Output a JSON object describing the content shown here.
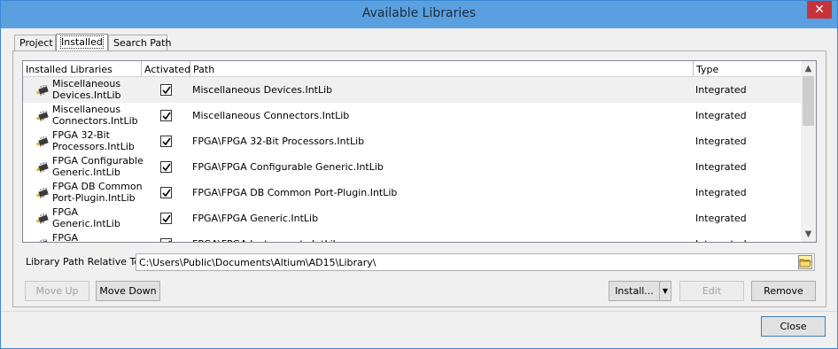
{
  "window": {
    "title": "Available Libraries",
    "close_glyph": "✕"
  },
  "tabs": [
    {
      "label": "Project"
    },
    {
      "label": "Installed"
    },
    {
      "label": "Search Path"
    }
  ],
  "grid": {
    "columns": [
      "Installed Libraries",
      "Activated",
      "Path",
      "Type"
    ],
    "rows": [
      {
        "name_l1": "Miscellaneous",
        "name_l2": "Devices.IntLib",
        "activated": true,
        "path": "Miscellaneous Devices.IntLib",
        "type": "Integrated"
      },
      {
        "name_l1": "Miscellaneous",
        "name_l2": "Connectors.IntLib",
        "activated": true,
        "path": "Miscellaneous Connectors.IntLib",
        "type": "Integrated"
      },
      {
        "name_l1": "FPGA 32-Bit",
        "name_l2": "Processors.IntLib",
        "activated": true,
        "path": "FPGA\\FPGA 32-Bit Processors.IntLib",
        "type": "Integrated"
      },
      {
        "name_l1": "FPGA Configurable",
        "name_l2": "Generic.IntLib",
        "activated": true,
        "path": "FPGA\\FPGA Configurable Generic.IntLib",
        "type": "Integrated"
      },
      {
        "name_l1": "FPGA DB Common",
        "name_l2": "Port-Plugin.IntLib",
        "activated": true,
        "path": "FPGA\\FPGA DB Common Port-Plugin.IntLib",
        "type": "Integrated"
      },
      {
        "name_l1": "FPGA",
        "name_l2": "Generic.IntLib",
        "activated": true,
        "path": "FPGA\\FPGA Generic.IntLib",
        "type": "Integrated"
      },
      {
        "name_l1": "FPGA",
        "name_l2": "",
        "activated": true,
        "path": "FPGA\\FPGA Instruments.IntLib",
        "type": "Integrated"
      }
    ]
  },
  "library_path": {
    "label": "Library Path Relative To:",
    "value": "C:\\Users\\Public\\Documents\\Altium\\AD15\\Library\\"
  },
  "buttons": {
    "move_up": "Move Up",
    "move_down": "Move Down",
    "install": "Install...",
    "edit": "Edit",
    "remove": "Remove",
    "close": "Close"
  },
  "icons": {
    "library": "library-chip-icon",
    "checkbox": "checkmark-icon",
    "browse": "folder-icon",
    "scroll_up": "▲",
    "scroll_down": "▼",
    "split_arrow": "▼"
  }
}
